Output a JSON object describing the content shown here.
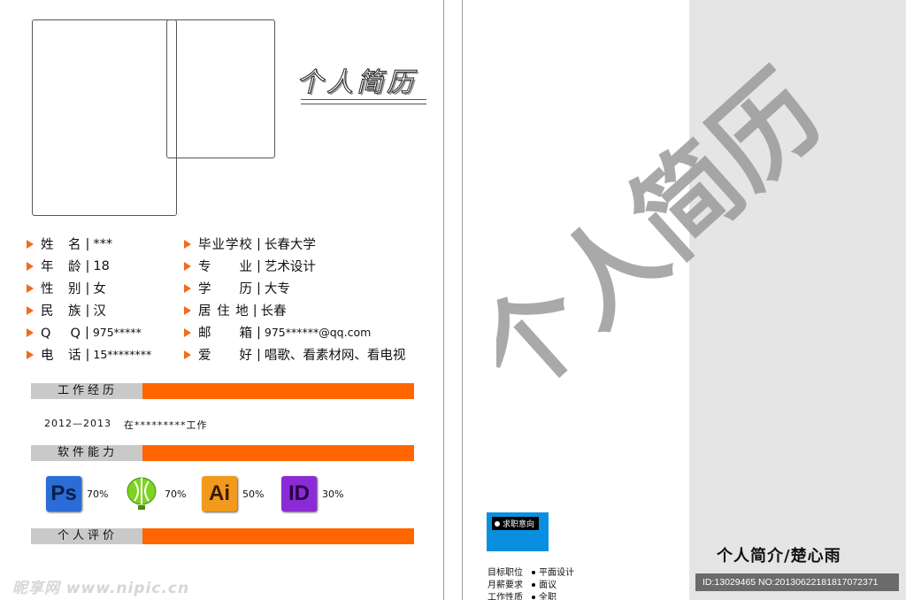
{
  "title": "个人简历",
  "info_left": [
    {
      "label": "姓　名",
      "value": "***"
    },
    {
      "label": "年　龄",
      "value": "18"
    },
    {
      "label": "性　别",
      "value": "女"
    },
    {
      "label": "民　族",
      "value": "汉"
    },
    {
      "label": "Q　 Q",
      "value": "975*****"
    },
    {
      "label": "电　话",
      "value": "15********"
    }
  ],
  "info_right": [
    {
      "label": "毕业学校",
      "value": "长春大学"
    },
    {
      "label": "专　　业",
      "value": "艺术设计"
    },
    {
      "label": "学　　历",
      "value": "大专"
    },
    {
      "label": "居 住 地",
      "value": "长春"
    },
    {
      "label": "邮　　箱",
      "value": "975******@qq.com"
    },
    {
      "label": "爱　　好",
      "value": "唱歌、看素材网、看电视"
    }
  ],
  "sections": {
    "work": "工作经历",
    "software": "软件能力",
    "evaluation": "个人评价"
  },
  "experience": {
    "years": "2012—2013",
    "desc": "在*********工作"
  },
  "software": [
    {
      "icon": "photoshop-icon",
      "abbr": "Ps",
      "percent": "70%",
      "color": "#2b6cd6"
    },
    {
      "icon": "coreldraw-icon",
      "abbr": "",
      "percent": "70%",
      "color": "#7cd320"
    },
    {
      "icon": "illustrator-icon",
      "abbr": "Ai",
      "percent": "50%",
      "color": "#f29a1b"
    },
    {
      "icon": "indesign-icon",
      "abbr": "ID",
      "percent": "30%",
      "color": "#8b2bd6"
    }
  ],
  "watermark": "昵享网 www.nipic.cn",
  "right_page": {
    "big_title": "个人简历",
    "job_intention": "求职意向",
    "job_rows": [
      {
        "label": "目标职位",
        "value": "平面设计"
      },
      {
        "label": "月薪要求",
        "value": "面议"
      },
      {
        "label": "工作性质",
        "value": "全职"
      }
    ],
    "intro": "个人简介/楚心雨",
    "id_text": "ID:13029465 NO:20130622181817072371"
  }
}
